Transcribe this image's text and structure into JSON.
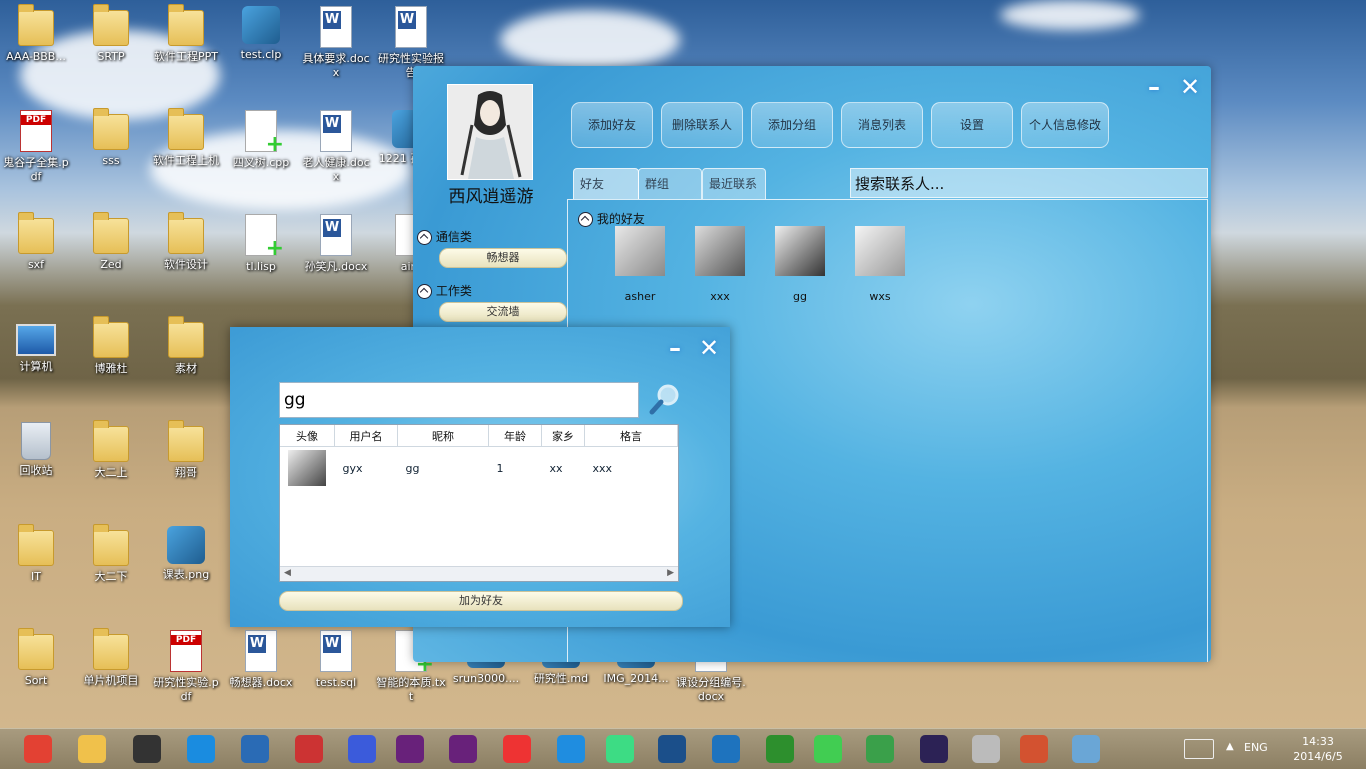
{
  "desktop": {
    "icons": [
      {
        "label": "AAA-BBB...",
        "type": "folder"
      },
      {
        "label": "SRTP",
        "type": "folder"
      },
      {
        "label": "软件工程PPT",
        "type": "folder"
      },
      {
        "label": "test.clp",
        "type": "app"
      },
      {
        "label": "具体要求.docx",
        "type": "doc"
      },
      {
        "label": "研究性实验报告",
        "type": "doc"
      },
      {
        "label": "鬼谷子全集.pdf",
        "type": "pdf"
      },
      {
        "label": "sss",
        "type": "folder"
      },
      {
        "label": "软件工程上机",
        "type": "folder"
      },
      {
        "label": "四叉树.cpp",
        "type": "cpp"
      },
      {
        "label": "老人健康.docx",
        "type": "doc"
      },
      {
        "label": "1221 孙笑凡",
        "type": "app"
      },
      {
        "label": "sxf",
        "type": "folder"
      },
      {
        "label": "Zed",
        "type": "folder"
      },
      {
        "label": "软件设计",
        "type": "folder"
      },
      {
        "label": "tl.lisp",
        "type": "cpp"
      },
      {
        "label": "孙笑凡.docx",
        "type": "doc"
      },
      {
        "label": "aim",
        "type": "cpp"
      },
      {
        "label": "计算机",
        "type": "pc"
      },
      {
        "label": "博雅杜",
        "type": "folder"
      },
      {
        "label": "素材",
        "type": "folder"
      },
      {
        "label": "回收站",
        "type": "bin"
      },
      {
        "label": "大二上",
        "type": "folder"
      },
      {
        "label": "翔哥",
        "type": "folder"
      },
      {
        "label": "IT",
        "type": "folder"
      },
      {
        "label": "大二下",
        "type": "folder"
      },
      {
        "label": "课表.png",
        "type": "app"
      },
      {
        "label": "Sort",
        "type": "folder"
      },
      {
        "label": "单片机项目",
        "type": "folder"
      },
      {
        "label": "研究性实验.pdf",
        "type": "pdf"
      },
      {
        "label": "畅想器.docx",
        "type": "doc"
      },
      {
        "label": "test.sql",
        "type": "doc"
      },
      {
        "label": "智能的本质.txt",
        "type": "cpp"
      },
      {
        "label": "srun3000....",
        "type": "app"
      },
      {
        "label": "研究性.md",
        "type": "app"
      },
      {
        "label": "IMG_2014...",
        "type": "app"
      },
      {
        "label": "课设分组编号.docx",
        "type": "doc"
      }
    ]
  },
  "main_window": {
    "nickname": "西风逍遥游",
    "buttons": [
      "添加好友",
      "删除联系人",
      "添加分组",
      "消息列表",
      "设置",
      "个人信息修改"
    ],
    "tabs": [
      "好友",
      "群组",
      "最近联系"
    ],
    "search_placeholder": "搜索联系人...",
    "sidebar_groups": [
      {
        "header": "通信类",
        "item": "畅想器"
      },
      {
        "header": "工作类",
        "item": "交流墙"
      }
    ],
    "friends_group": "我的好友",
    "friends": [
      "asher",
      "xxx",
      "gg",
      "wxs"
    ]
  },
  "search_dialog": {
    "query": "gg",
    "columns": [
      "头像",
      "用户名",
      "昵称",
      "年龄",
      "家乡",
      "格言"
    ],
    "rows": [
      {
        "username": "gyx",
        "nickname": "gg",
        "age": "1",
        "hometown": "xx",
        "motto": "xxx"
      }
    ],
    "add_button": "加为好友"
  },
  "taskbar": {
    "apps": [
      "chrome",
      "explorer",
      "sublime",
      "qq",
      "thunderbird",
      "editor",
      "infinity",
      "visual-studio",
      "visual-studio-2",
      "puzzle",
      "jetbrains",
      "android",
      "eight",
      "terminal",
      "tree",
      "qt",
      "ball",
      "eclipse",
      "cat-photo",
      "powerpoint",
      "flower"
    ],
    "lang": "ENG",
    "time": "14:33",
    "date": "2014/6/5"
  }
}
